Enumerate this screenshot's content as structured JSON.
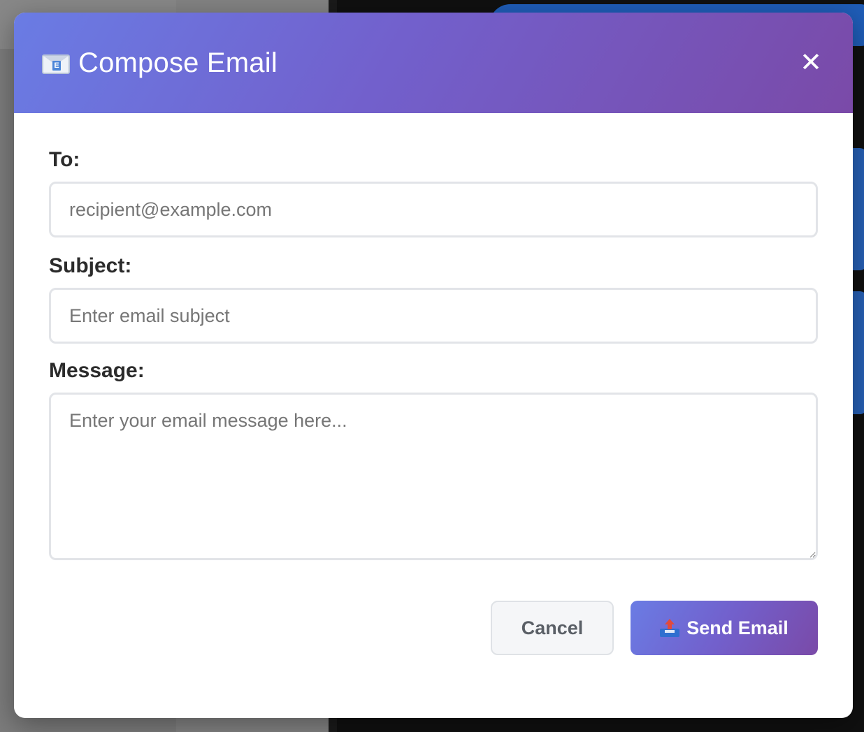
{
  "modal": {
    "title": "Compose Email",
    "title_icon": "envelope-icon",
    "close_icon": "close-icon",
    "close_glyph": "✕"
  },
  "form": {
    "to": {
      "label": "To:",
      "placeholder": "recipient@example.com",
      "value": ""
    },
    "subject": {
      "label": "Subject:",
      "placeholder": "Enter email subject",
      "value": ""
    },
    "message": {
      "label": "Message:",
      "placeholder": "Enter your email message here...",
      "value": ""
    }
  },
  "actions": {
    "cancel_label": "Cancel",
    "send_label": "Send Email",
    "send_icon": "outbox-tray-icon"
  },
  "colors": {
    "header_gradient_start": "#6a7ce4",
    "header_gradient_end": "#7a4aa8",
    "label_text": "#2b2b2b",
    "input_border": "#e2e4e8"
  }
}
